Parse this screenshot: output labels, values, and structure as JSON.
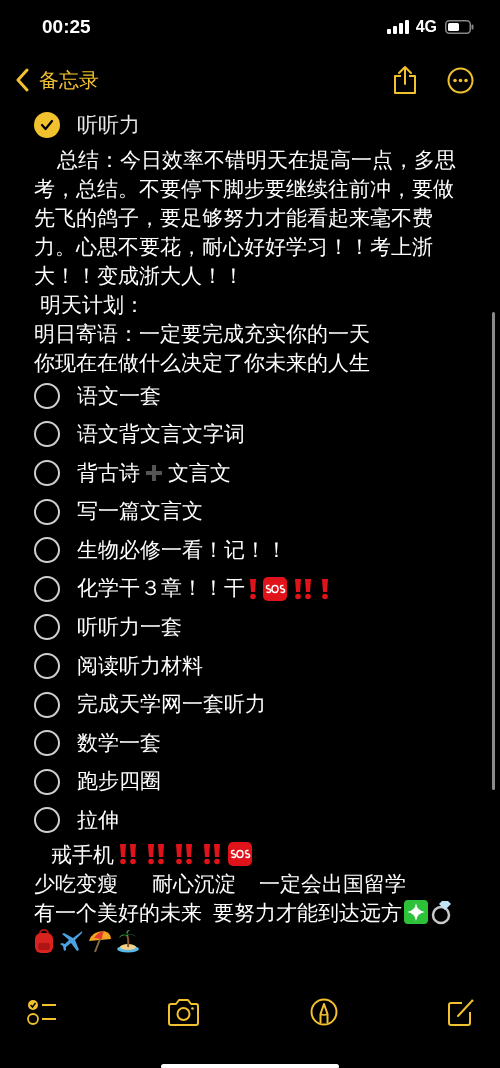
{
  "status_bar": {
    "time": "00:25",
    "network": "4G"
  },
  "nav": {
    "back_label": "备忘录"
  },
  "note": [
    {
      "kind": "checklist",
      "text": "听听力",
      "checked": true
    },
    {
      "kind": "paragraph",
      "text": "    总结：今日效率不错明天在提高一点，多思考，总结。不要停下脚步要继续往前冲，要做先飞的鸽子，要足够努力才能看起来毫不费力。心思不要花，耐心好好学习！！考上浙大！！变成浙大人！！"
    },
    {
      "kind": "paragraph",
      "text": " 明天计划："
    },
    {
      "kind": "paragraph",
      "text": "明日寄语：一定要完成充实你的一天"
    },
    {
      "kind": "paragraph",
      "text": "你现在在做什么决定了你未来的人生"
    },
    {
      "kind": "checklist",
      "text": "语文一套",
      "checked": false
    },
    {
      "kind": "checklist",
      "text": "语文背文言文字词",
      "checked": false
    },
    {
      "kind": "checklist",
      "text": "背古诗",
      "text_after": "文言文",
      "checked": false
    },
    {
      "kind": "checklist",
      "text": "写一篇文言文",
      "checked": false
    },
    {
      "kind": "checklist",
      "text": "生物必修一看！记！！",
      "checked": false
    },
    {
      "kind": "checklist",
      "text": "化学干３章！！干",
      "checked": false
    },
    {
      "kind": "checklist",
      "text": "听听力一套",
      "checked": false
    },
    {
      "kind": "checklist",
      "text": "阅读听力材料",
      "checked": false
    },
    {
      "kind": "checklist",
      "text": "完成天学网一套听力",
      "checked": false
    },
    {
      "kind": "checklist",
      "text": "数学一套",
      "checked": false
    },
    {
      "kind": "checklist",
      "text": "跑步四圈",
      "checked": false
    },
    {
      "kind": "checklist",
      "text": "拉伸",
      "checked": false
    },
    {
      "kind": "paragraph",
      "text": "   戒手机"
    },
    {
      "kind": "paragraph",
      "text": "少吃变瘦      耐心沉淀    一定会出国留学"
    },
    {
      "kind": "paragraph",
      "text": "有一个美好的未来  要努力才能到达远方"
    },
    {
      "kind": "icons"
    }
  ]
}
